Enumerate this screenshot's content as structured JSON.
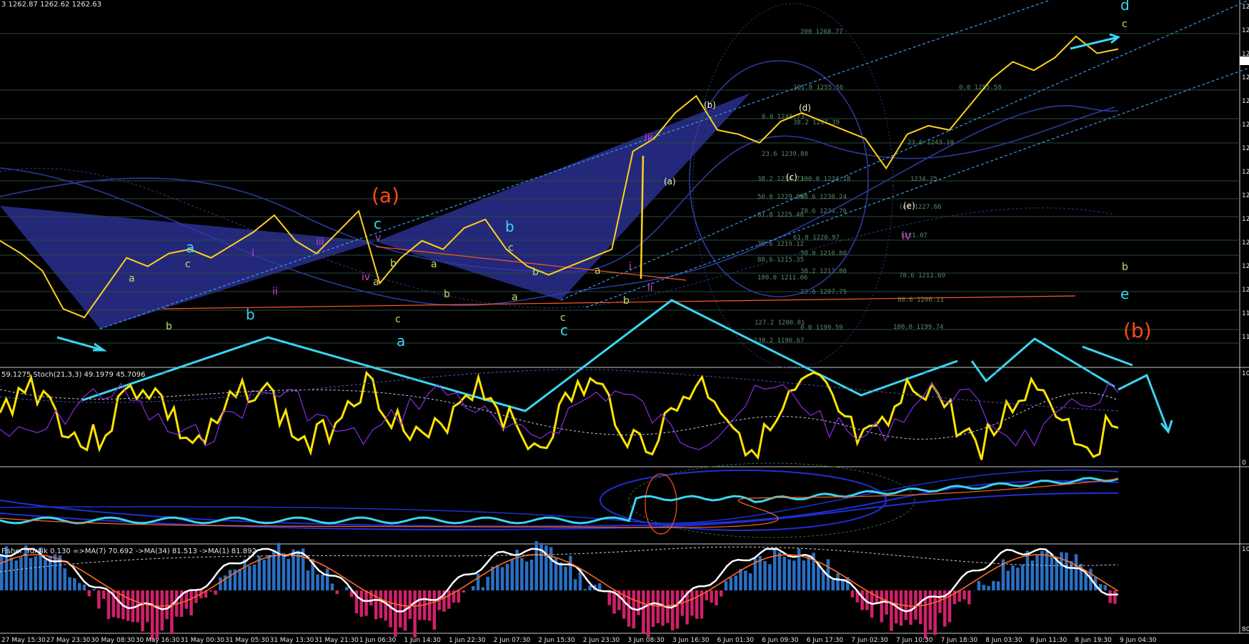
{
  "chart_data": {
    "type": "line",
    "title": "",
    "header_text": "3 1262.87 1262.62 1262.63",
    "colors": {
      "background": "#000000",
      "price": "#ffd21a",
      "cyan": "#3ad6f0",
      "channel": "#2e3a9a",
      "triangle": "#2a2f8f",
      "red_label": "#ff4a12",
      "fib": "#5c8a6e",
      "magenta": "#d040d8",
      "white_text": "#ffffff"
    },
    "price_axis": [
      "12",
      "12",
      "12",
      "12",
      "12",
      "12",
      "12",
      "12",
      "12",
      "12",
      "12",
      "12",
      "12",
      "11",
      "11"
    ],
    "time_labels": [
      "27 May 15:30",
      "27 May 23:30",
      "30 May 08:30",
      "30 May 16:30",
      "31 May 00:30",
      "31 May 05:30",
      "31 May 13:30",
      "31 May 21:30",
      "1 Jun 06:30",
      "1 Jun 14:30",
      "1 Jun 22:30",
      "2 Jun 07:30",
      "2 Jun 15:30",
      "2 Jun 23:30",
      "3 Jun 08:30",
      "3 Jun 16:30",
      "6 Jun 01:30",
      "6 Jun 09:30",
      "6 Jun 17:30",
      "7 Jun 02:30",
      "7 Jun 10:30",
      "7 Jun 18:30",
      "8 Jun 03:30",
      "8 Jun 11:30",
      "8 Jun 19:30",
      "9 Jun 04:30"
    ],
    "fib_levels": [
      "200 1268.77",
      "161.8 1255.56",
      "0.0 1255.58",
      "0.0 1248.73",
      "38.2 1247.39",
      "23.6 1243.10",
      "23.6 1239.88",
      "38.2 1234.73",
      "100.0 1234.18",
      "1234.25",
      "50.0 1229.89",
      "88.6 1230.24",
      "61.8 1225.40",
      "78.6 1224.76",
      "(e) 1227.66",
      "61.8 1220.97",
      "1221.07",
      "78.6 1219.12",
      "50.0 1216.88",
      "88.6 1215.35",
      "38.2 1212.80",
      "100.0 1211.06",
      "78.6 1211.69",
      "23.6 1207.75",
      "88.6 1206.11",
      "127.2 1200.81",
      "0.0 1199.59",
      "100.0 1199.74",
      "138.2 1196.67"
    ],
    "wave_labels": {
      "big_a": "(a)",
      "big_b": "(b)",
      "c_cyan": "c",
      "a_cyan_1": "a",
      "b_cyan_1": "b",
      "a_cyan_2": "a",
      "b_cyan_2": "b",
      "c_cyan_2": "c",
      "d_cyan": "d",
      "e_cyan": "e",
      "a_yg": "a",
      "b_yg": "b",
      "c_yg": "c",
      "roman_i": "i",
      "roman_ii": "ii",
      "roman_iii": "iii",
      "roman_iv": "iv",
      "roman_v": "v",
      "p_a": "(a)",
      "p_b": "(b)",
      "p_c": "(c)",
      "p_d": "(d)",
      "p_e": "(e)",
      "pivot_iv": "iv",
      "pivot_iii": "iii",
      "pivot_i": "i",
      "pivot_ii": "ii"
    },
    "stoch": {
      "label": "59.1275  Stoch(21,3,3) 49.1979 45.7096",
      "scale_top": "100",
      "scale_bottom": "0"
    },
    "fisher": {
      "label": "Fisher_Yur4ik 0.130  =>MA(7) 70.692  ->MA(34) 81.513  ->MA(1) 81.892",
      "scale_top": "100",
      "scale_bottom": "80"
    },
    "price_series_desc": "EUR-style 30m price path",
    "price_points_y": [
      1216,
      1213,
      1209,
      1200,
      1198,
      1205,
      1212,
      1210,
      1213,
      1214,
      1212,
      1215,
      1218,
      1222,
      1216,
      1213,
      1218,
      1223,
      1206,
      1212,
      1216,
      1214,
      1219,
      1221,
      1214,
      1210,
      1208,
      1210,
      1212,
      1214,
      1237,
      1240,
      1246,
      1250,
      1242,
      1241,
      1239,
      1244,
      1246,
      1244,
      1242,
      1240,
      1233,
      1241,
      1243,
      1242,
      1248,
      1254,
      1258,
      1256,
      1259,
      1264,
      1260,
      1261
    ]
  }
}
